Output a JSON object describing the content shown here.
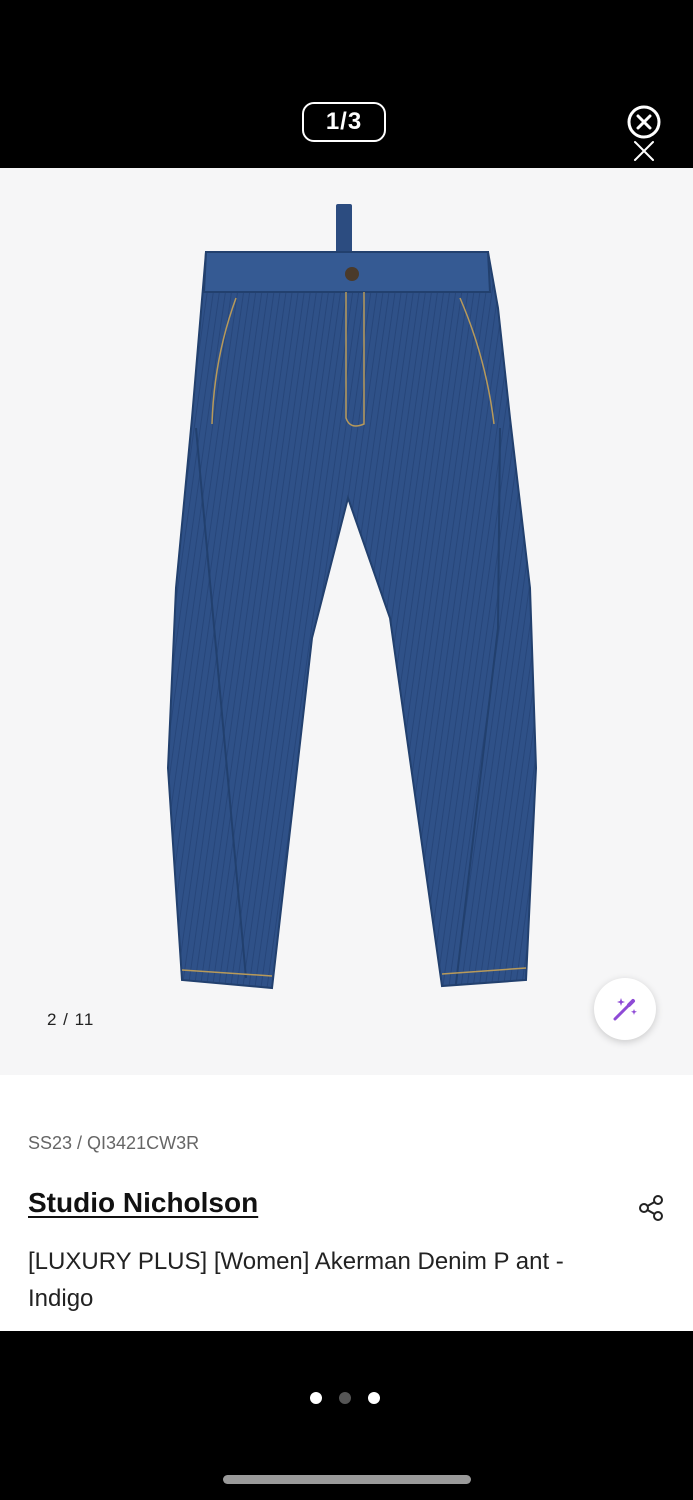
{
  "viewer": {
    "page_counter": "1/3",
    "close_icon": "close-circle-icon"
  },
  "product_image": {
    "subject": "indigo denim pants",
    "image_counter": "2 / 11",
    "magic_icon": "magic-wand-icon"
  },
  "product": {
    "sku": "SS23 / QI3421CW3R",
    "brand": "Studio Nicholson",
    "name": "[LUXURY PLUS] [Women] Akerman Denim P ant - Indigo",
    "share_icon": "share-icon"
  },
  "pagination": {
    "total": 3,
    "active_index": 0
  },
  "colors": {
    "background": "#000000",
    "photo_bg": "#f6f6f7",
    "denim": "#2f5188",
    "accent_purple": "#8e4ad6"
  }
}
